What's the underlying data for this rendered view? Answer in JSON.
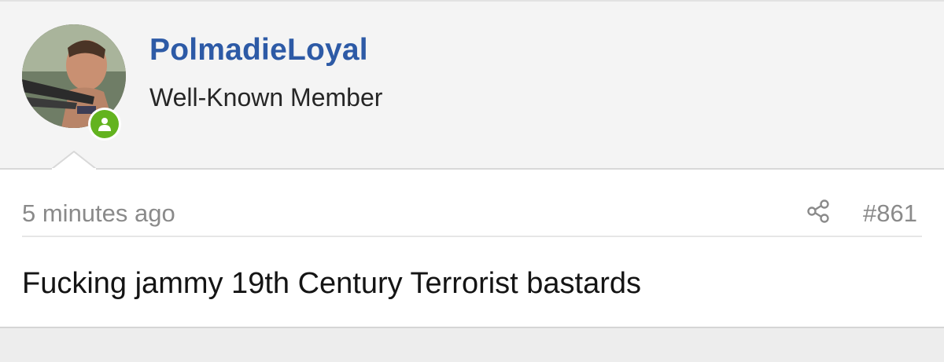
{
  "user": {
    "name": "PolmadieLoyal",
    "title": "Well-Known Member",
    "status_color": "#63b31f"
  },
  "post": {
    "time": "5 minutes ago",
    "number": "#861",
    "body": "Fucking jammy 19th Century Terrorist bastards"
  },
  "icons": {
    "share": "share-icon",
    "online": "user-online-icon"
  },
  "colors": {
    "username": "#2d5aa6",
    "meta_text": "#8a8a8a"
  }
}
